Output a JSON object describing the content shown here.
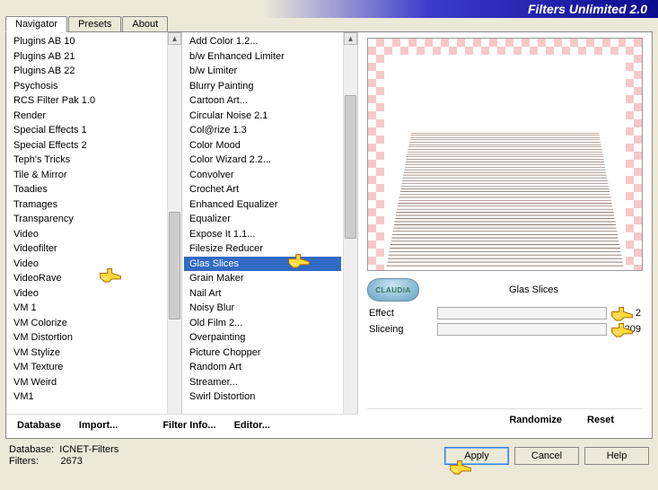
{
  "title": "Filters Unlimited 2.0",
  "tabs": [
    "Navigator",
    "Presets",
    "About"
  ],
  "active_tab": 0,
  "left_list": [
    "Plugins AB 10",
    "Plugins AB 21",
    "Plugins AB 22",
    "Psychosis",
    "RCS Filter Pak 1.0",
    "Render",
    "Special Effects 1",
    "Special Effects 2",
    "Teph's Tricks",
    "Tile & Mirror",
    "Toadies",
    "Tramages",
    "Transparency",
    "Video",
    "Videofilter",
    "Video",
    "VideoRave",
    "Video",
    "VM 1",
    "VM Colorize",
    "VM Distortion",
    "VM Stylize",
    "VM Texture",
    "VM Weird",
    "VM1"
  ],
  "right_list": [
    "Add Color 1.2...",
    "b/w Enhanced Limiter",
    "b/w Limiter",
    "Blurry Painting",
    "Cartoon Art...",
    "Circular Noise 2.1",
    "Col@rize 1.3",
    "Color Mood",
    "Color Wizard 2.2...",
    "Convolver",
    "Crochet Art",
    "Enhanced Equalizer",
    "Equalizer",
    "Expose It 1.1...",
    "Filesize Reducer",
    "Glas Slices",
    "Grain Maker",
    "Nail Art",
    "Noisy Blur",
    "Old Film 2...",
    "Overpainting",
    "Picture Chopper",
    "Random Art",
    "Streamer...",
    "Swirl Distortion"
  ],
  "right_selected": 15,
  "left_buttons": [
    "Database",
    "Import..."
  ],
  "mid_buttons": [
    "Filter Info...",
    "Editor..."
  ],
  "preview_buttons": [
    "Randomize",
    "Reset"
  ],
  "preview": {
    "name": "Glas Slices",
    "badge": "CLAUDIA"
  },
  "sliders": [
    {
      "label": "Effect",
      "value": 2
    },
    {
      "label": "Sliceing",
      "value": 209
    }
  ],
  "footer": {
    "db_label": "Database:",
    "db_value": "ICNET-Filters",
    "filters_label": "Filters:",
    "filters_value": "2673",
    "buttons": [
      "Apply",
      "Cancel",
      "Help"
    ]
  }
}
